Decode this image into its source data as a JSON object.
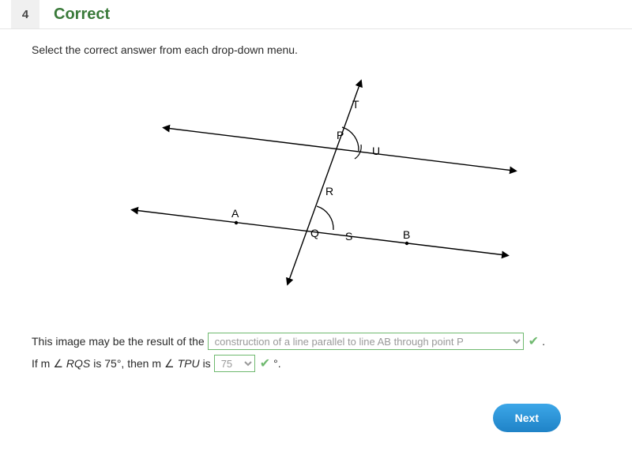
{
  "header": {
    "question_number": "4",
    "status": "Correct"
  },
  "prompt": "Select the correct answer from each drop-down menu.",
  "diagram": {
    "labels": {
      "t": "T",
      "p": "P",
      "u": "U",
      "r": "R",
      "q": "Q",
      "s": "S",
      "a": "A",
      "b": "B"
    }
  },
  "line1": {
    "prefix": "This image may be the result of the",
    "selected": "construction of a line parallel to line AB through point P",
    "suffix": "."
  },
  "line2": {
    "prefix_a": "If m",
    "angle1": "RQS",
    "mid_a": " is 75°, then m",
    "angle2": "TPU",
    "mid_b": " is",
    "selected": "75",
    "suffix": "°."
  },
  "footer": {
    "next_label": "Next"
  },
  "chart_data": {
    "type": "diagram",
    "title": "Two parallel lines cut by a transversal, with construction arcs at P and Q",
    "lines": [
      {
        "name": "AB",
        "through": [
          "A",
          "Q",
          "S",
          "B"
        ]
      },
      {
        "name": "PU",
        "through": [
          "P",
          "U"
        ],
        "parallel_to": "AB"
      },
      {
        "name": "transversal",
        "through": [
          "T",
          "P",
          "R",
          "Q"
        ]
      }
    ],
    "points": [
      "T",
      "P",
      "U",
      "R",
      "Q",
      "S",
      "A",
      "B"
    ],
    "given_angle": {
      "vertex": "Q",
      "rays": [
        "R",
        "S"
      ],
      "measure_deg": 75
    },
    "asked_angle": {
      "vertex": "P",
      "rays": [
        "T",
        "U"
      ],
      "measure_deg": 75
    }
  }
}
